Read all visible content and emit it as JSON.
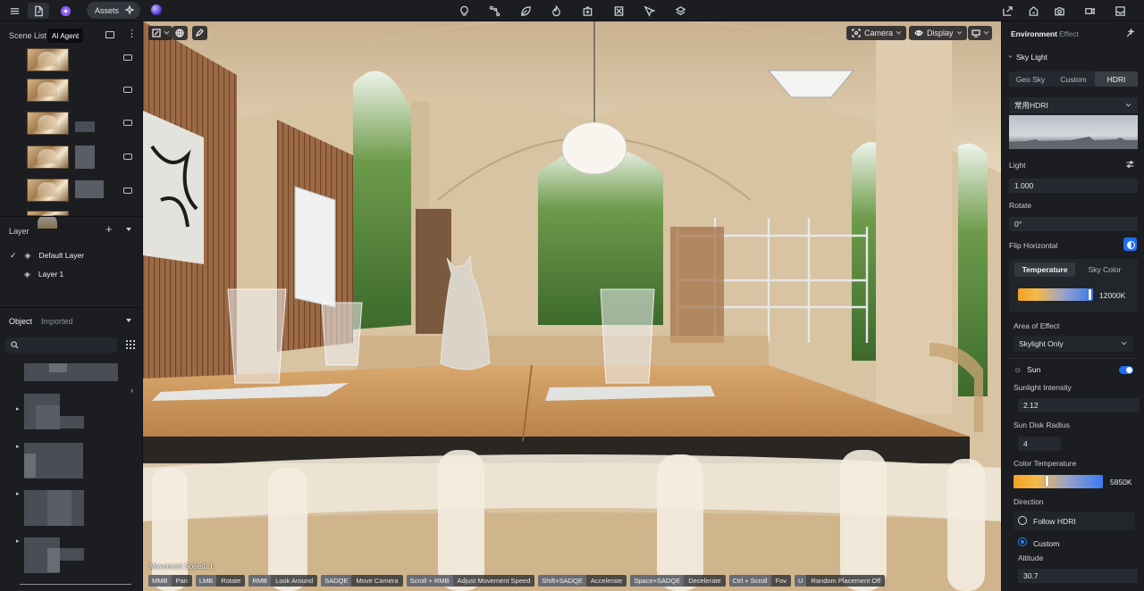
{
  "topbar": {
    "assets_label": "Assets"
  },
  "left": {
    "scene_list_title": "Scene List",
    "ai_agent_tooltip": "AI Agent",
    "layer_title": "Layer",
    "layers": [
      {
        "name": "Default Layer",
        "checked": true
      },
      {
        "name": "Layer 1",
        "checked": false
      }
    ],
    "object_tab": "Object",
    "imported_tab": "Imported",
    "search_placeholder": ""
  },
  "viewport": {
    "camera_label": "Camera",
    "display_label": "Display",
    "movement_speed": "Movement Speed: 1",
    "hints": [
      {
        "key": "MMB",
        "label": "Pan"
      },
      {
        "key": "LMB",
        "label": "Rotate"
      },
      {
        "key": "RMB",
        "label": "Look Around"
      },
      {
        "key": "SADQE",
        "label": "Move Camera"
      },
      {
        "key": "Scroll + RMB",
        "label": "Adjust Movement Speed"
      },
      {
        "key": "Shift+SADQE",
        "label": "Accelerate"
      },
      {
        "key": "Space+SADQE",
        "label": "Decelerate"
      },
      {
        "key": "Ctrl + Scroll",
        "label": "Fov"
      },
      {
        "key": "U",
        "label": "Random Placement Off"
      }
    ]
  },
  "right": {
    "tab_environment": "Environment",
    "tab_effect": "Effect",
    "sky_light_title": "Sky Light",
    "sky_modes": [
      "Geo Sky",
      "Custom",
      "HDRI"
    ],
    "sky_mode_active": "HDRI",
    "hdri_select": "常用HDRI",
    "light_label": "Light",
    "light_value": "1.000",
    "rotate_label": "Rotate",
    "rotate_value": "0°",
    "flip_label": "Flip Horizontal",
    "temp_tabs": [
      "Temperature",
      "Sky Color"
    ],
    "temp_value": "12000K",
    "temp_level": 0.97,
    "area_label": "Area of Effect",
    "area_value": "Skylight Only",
    "sun_label": "Sun",
    "sunlight_label": "Sunlight Intensity",
    "sunlight_value": "2.12",
    "disk_label": "Sun Disk Radius",
    "disk_value": "4",
    "color_temp_label": "Color Temperature",
    "color_temp_value": "5850K",
    "color_temp_level": 0.38,
    "direction_label": "Direction",
    "follow_hdri": "Follow HDRI",
    "custom_label": "Custom",
    "altitude_label": "Altitude",
    "altitude_value": "30.7"
  }
}
